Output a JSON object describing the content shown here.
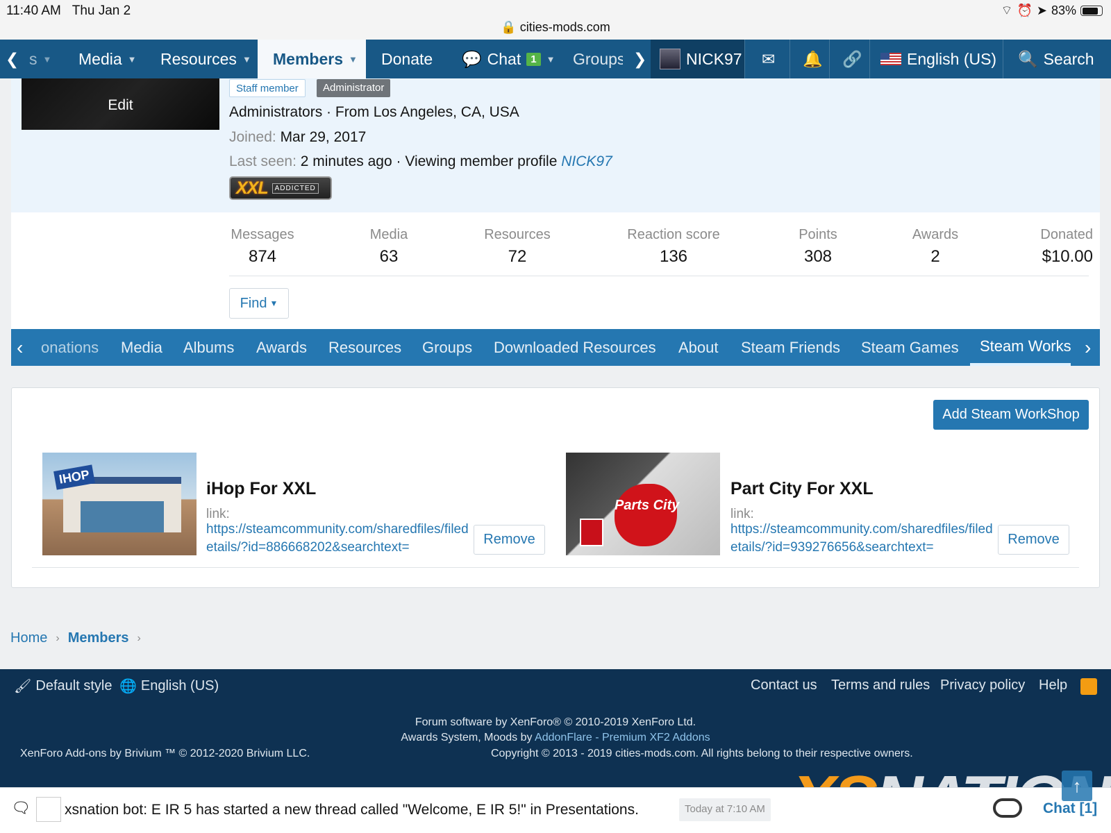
{
  "status": {
    "time": "11:40 AM",
    "date": "Thu Jan 2",
    "url": "cities-mods.com",
    "battery": "83%"
  },
  "nav": {
    "partial_first": "s",
    "media": "Media",
    "resources": "Resources",
    "members": "Members",
    "donate": "Donate",
    "chat": "Chat",
    "chat_count": "1",
    "groups": "Groups",
    "user": "NICK97",
    "language": "English (US)",
    "search": "Search"
  },
  "profile": {
    "edit": "Edit",
    "tag_staff": "Staff member",
    "tag_admin": "Administrator",
    "line1": "Administrators · From Los Angeles, CA, USA",
    "joined_label": "Joined:",
    "joined": "Mar 29, 2017",
    "last_seen_label": "Last seen:",
    "last_seen": "2 minutes ago · Viewing member profile",
    "last_seen_link": "NICK97",
    "trophy_big": "XXL",
    "trophy_small": "ADDICTED"
  },
  "stats": [
    {
      "label": "Messages",
      "value": "874"
    },
    {
      "label": "Media",
      "value": "63"
    },
    {
      "label": "Resources",
      "value": "72"
    },
    {
      "label": "Reaction score",
      "value": "136"
    },
    {
      "label": "Points",
      "value": "308"
    },
    {
      "label": "Awards",
      "value": "2"
    },
    {
      "label": "Donated",
      "value": "$10.00"
    }
  ],
  "find": "Find",
  "tabs": [
    "onations",
    "Media",
    "Albums",
    "Awards",
    "Resources",
    "Groups",
    "Downloaded Resources",
    "About",
    "Steam Friends",
    "Steam Games",
    "Steam Works"
  ],
  "workshop": {
    "add": "Add Steam WorkShop",
    "items": [
      {
        "title": "iHop For XXL",
        "link_label": "link:",
        "url": "https://steamcommunity.com/sharedfiles/filedetails/?id=886668202&searchtext=",
        "remove": "Remove",
        "thumb_text": "IHOP"
      },
      {
        "title": "Part City For XXL",
        "link_label": "link:",
        "url": "https://steamcommunity.com/sharedfiles/filedetails/?id=939276656&searchtext=",
        "remove": "Remove",
        "thumb_text": "Parts City"
      }
    ]
  },
  "breadcrumb": {
    "home": "Home",
    "members": "Members"
  },
  "footer": {
    "style": "Default style",
    "language": "English (US)",
    "links": [
      "Contact us",
      "Terms and rules",
      "Privacy policy",
      "Help"
    ],
    "line1": "Forum software by XenForo® © 2010-2019 XenForo Ltd.",
    "line2_prefix": "Awards System, Moods by",
    "line2_link": "AddonFlare - Premium XF2 Addons",
    "line3_left": "XenForo Add-ons by Brivium ™ © 2012-2020 Brivium LLC.",
    "line3_right": "Copyright © 2013 - 2019 cities-mods.com. All rights belong to their respective owners.",
    "watermark_x": "XS",
    "watermark_n": "NATION"
  },
  "chatbar": {
    "message": "xsnation bot: E IR 5 has started a new thread called \"Welcome, E IR 5!\" in Presentations.",
    "time": "Today at 7:10 AM",
    "label": "Chat [1]"
  },
  "colors": {
    "nav": "#185886",
    "accent": "#2577b1",
    "footer": "#0e3152"
  }
}
